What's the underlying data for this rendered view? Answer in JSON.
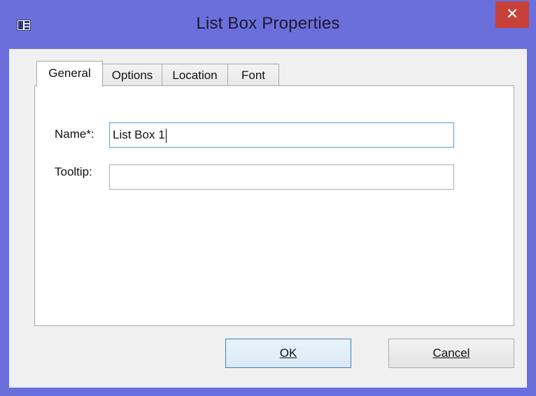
{
  "window": {
    "title": "List Box Properties",
    "icon": "list-box-icon",
    "close_icon": "close-icon"
  },
  "tabs": [
    {
      "label": "General",
      "active": true
    },
    {
      "label": "Options",
      "active": false
    },
    {
      "label": "Location",
      "active": false
    },
    {
      "label": "Font",
      "active": false
    }
  ],
  "general": {
    "name_label": "Name*:",
    "name_value": "List Box 1",
    "tooltip_label": "Tooltip:",
    "tooltip_value": ""
  },
  "buttons": {
    "ok_label": "OK",
    "cancel_label": "Cancel"
  },
  "colors": {
    "frame": "#6b6fdc",
    "close": "#c7403a",
    "focus_border": "#569de5"
  }
}
